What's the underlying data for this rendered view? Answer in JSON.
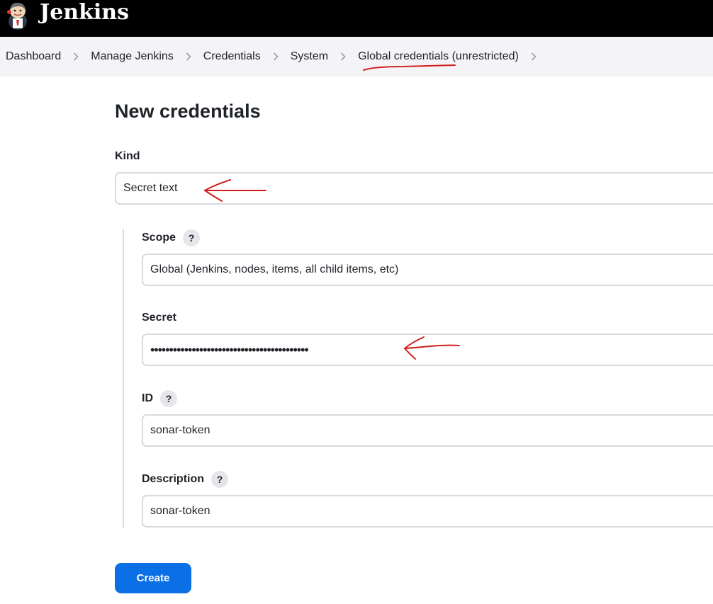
{
  "header": {
    "brand": "Jenkins",
    "logo_icon": "jenkins-butler-logo",
    "background_color": "#000000"
  },
  "breadcrumb": {
    "items": [
      {
        "label": "Dashboard"
      },
      {
        "label": "Manage Jenkins"
      },
      {
        "label": "Credentials"
      },
      {
        "label": "System"
      },
      {
        "label": "Global credentials (unrestricted)"
      }
    ],
    "separator_icon": "chevron-right-icon"
  },
  "form": {
    "title": "New credentials",
    "kind": {
      "label": "Kind",
      "value": "Secret text"
    },
    "scope": {
      "label": "Scope",
      "help": "?",
      "value": "Global (Jenkins, nodes, items, all child items, etc)"
    },
    "secret": {
      "label": "Secret",
      "value": "••••••••••••••••••••••••••••••••••••••••••"
    },
    "id": {
      "label": "ID",
      "help": "?",
      "value": "sonar-token"
    },
    "description": {
      "label": "Description",
      "help": "?",
      "value": "sonar-token"
    },
    "create_label": "Create"
  },
  "colors": {
    "primary_button": "#0b6fe6",
    "annotation": "#d11f1f"
  }
}
